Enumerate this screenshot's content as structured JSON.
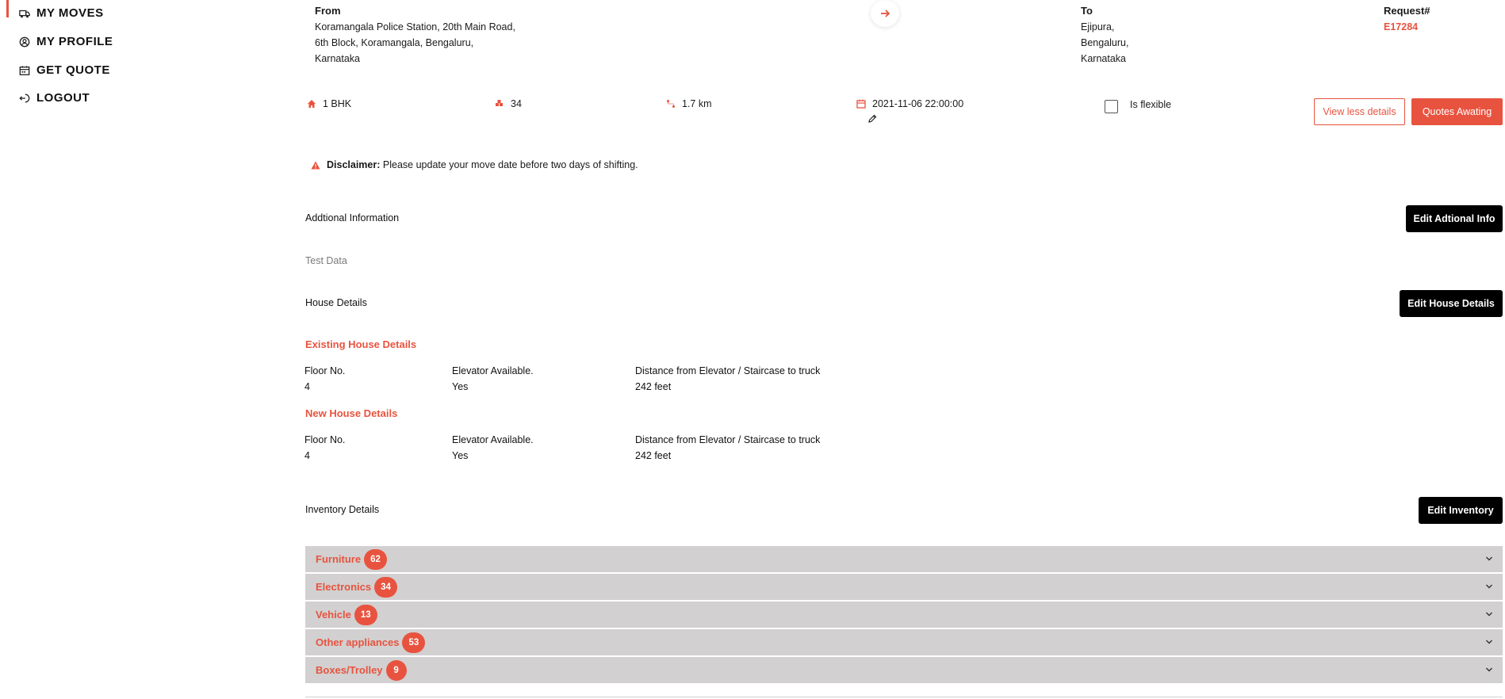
{
  "sidebar": {
    "items": [
      {
        "label": "MY MOVES",
        "icon": "truck-icon"
      },
      {
        "label": "MY PROFILE",
        "icon": "user-circle-icon"
      },
      {
        "label": "GET QUOTE",
        "icon": "calendar-icon"
      },
      {
        "label": "LOGOUT",
        "icon": "logout-icon"
      }
    ],
    "active_index": 0
  },
  "move": {
    "from_label": "From",
    "from_lines": [
      "Koramangala Police Station, 20th Main Road,",
      "6th Block, Koramangala, Bengaluru,",
      "Karnataka"
    ],
    "to_label": "To",
    "to_lines": [
      "Ejipura,",
      "Bengaluru,",
      "Karnataka"
    ],
    "request_label": "Request#",
    "request_id": "E17284",
    "house_type": "1 BHK",
    "items_count": "34",
    "distance": "1.7 km",
    "move_datetime": "2021-11-06 22:00:00",
    "flexible_label": "Is flexible",
    "flexible_checked": false
  },
  "buttons": {
    "view_less": "View less details",
    "quotes": "Quotes Awating",
    "edit_additional": "Edit Adtional Info",
    "edit_house": "Edit House Details",
    "edit_inventory": "Edit Inventory"
  },
  "disclaimer": {
    "title": "Disclaimer:",
    "text": "Please update your move date before two days of shifting."
  },
  "additional": {
    "label": "Addtional Information",
    "value": "Test Data"
  },
  "house": {
    "label": "House Details",
    "existing": {
      "title": "Existing House Details",
      "floor_label": "Floor No.",
      "floor": "4",
      "elevator_label": "Elevator Available.",
      "elevator": "Yes",
      "distance_label": "Distance from Elevator / Staircase to truck",
      "distance": "242 feet"
    },
    "new": {
      "title": "New House Details",
      "floor_label": "Floor No.",
      "floor": "4",
      "elevator_label": "Elevator Available.",
      "elevator": "Yes",
      "distance_label": "Distance from Elevator / Staircase to truck",
      "distance": "242 feet"
    }
  },
  "inventory": {
    "label": "Inventory Details",
    "categories": [
      {
        "name": "Furniture",
        "count": "62"
      },
      {
        "name": "Electronics",
        "count": "34"
      },
      {
        "name": "Vehicle",
        "count": "13"
      },
      {
        "name": "Other appliances",
        "count": "53"
      },
      {
        "name": "Boxes/Trolley",
        "count": "9"
      }
    ]
  },
  "colors": {
    "accent": "#e8533f",
    "accordion_bg": "#d2d0d0",
    "dark_button": "#000000"
  }
}
